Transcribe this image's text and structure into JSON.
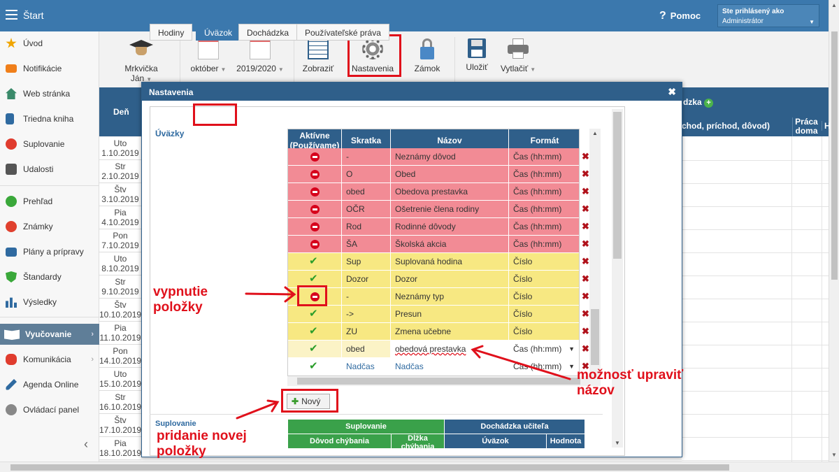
{
  "topbar": {
    "title": "Štart",
    "help": "Pomoc",
    "user_label": "Ste prihlásený ako",
    "user_name": "Administrátor"
  },
  "sidebar": {
    "items": [
      {
        "label": "Úvod",
        "icon": "star-icon",
        "color": "#f0a500"
      },
      {
        "label": "Notifikácie",
        "icon": "envelope-icon",
        "color": "#f07f1a"
      },
      {
        "label": "Web stránka",
        "icon": "home-icon",
        "color": "#3a8a6a"
      },
      {
        "label": "Triedna kniha",
        "icon": "book-icon",
        "color": "#2f6aa0"
      },
      {
        "label": "Suplovanie",
        "icon": "person-icon",
        "color": "#e03c2e"
      },
      {
        "label": "Udalosti",
        "icon": "calendar-icon",
        "color": "#555555"
      },
      {
        "label": "Prehľad",
        "icon": "check-circle-icon",
        "color": "#3aa83a"
      },
      {
        "label": "Známky",
        "icon": "grades-icon",
        "color": "#e0402e"
      },
      {
        "label": "Plány a prípravy",
        "icon": "briefcase-icon",
        "color": "#2f6aa0"
      },
      {
        "label": "Štandardy",
        "icon": "shield-icon",
        "color": "#3aa83a"
      },
      {
        "label": "Výsledky",
        "icon": "bar-chart-icon",
        "color": "#2f6aa0"
      },
      {
        "label": "Vyučovanie",
        "icon": "open-book-icon",
        "color": "#ffffff"
      },
      {
        "label": "Komunikácia",
        "icon": "chat-icon",
        "color": "#e03c2e"
      },
      {
        "label": "Agenda Online",
        "icon": "pen-icon",
        "color": "#2f6aa0"
      },
      {
        "label": "Ovládací panel",
        "icon": "gear-icon",
        "color": "#888888"
      }
    ]
  },
  "toolbar": {
    "teacher": "Mrkvička Ján",
    "month": "október",
    "year": "2019/2020",
    "show": "Zobraziť",
    "settings": "Nastavenia",
    "lock": "Zámok",
    "save": "Uložiť",
    "print": "Vytlačiť"
  },
  "grid": {
    "day_header": "Deň",
    "right_header_a": "dzka",
    "right_header_b": "chod, príchod, dôvod)",
    "right_header_c": "Práca doma",
    "right_header_d": "H",
    "days": [
      {
        "d": "Uto",
        "date": "1.10.2019"
      },
      {
        "d": "Str",
        "date": "2.10.2019"
      },
      {
        "d": "Štv",
        "date": "3.10.2019"
      },
      {
        "d": "Pia",
        "date": "4.10.2019"
      },
      {
        "d": "Pon",
        "date": "7.10.2019"
      },
      {
        "d": "Uto",
        "date": "8.10.2019"
      },
      {
        "d": "Str",
        "date": "9.10.2019"
      },
      {
        "d": "Štv",
        "date": "10.10.2019"
      },
      {
        "d": "Pia",
        "date": "11.10.2019"
      },
      {
        "d": "Pon",
        "date": "14.10.2019"
      },
      {
        "d": "Uto",
        "date": "15.10.2019"
      },
      {
        "d": "Str",
        "date": "16.10.2019"
      },
      {
        "d": "Štv",
        "date": "17.10.2019"
      },
      {
        "d": "Pia",
        "date": "18.10.2019"
      }
    ]
  },
  "dialog": {
    "title": "Nastavenia",
    "tabs": [
      "Hodiny",
      "Úväzok",
      "Dochádzka",
      "Používateľské práva"
    ],
    "section": "Úväzky",
    "columns": [
      "Aktívne (Používame)",
      "Skratka",
      "Názov",
      "Formát"
    ],
    "rows": [
      {
        "active": false,
        "abbr": "-",
        "name": "Neznámy dôvod",
        "format": "Čas (hh:mm)",
        "bg": "#f28b95"
      },
      {
        "active": false,
        "abbr": "O",
        "name": "Obed",
        "format": "Čas (hh:mm)",
        "bg": "#f28b95"
      },
      {
        "active": false,
        "abbr": "obed",
        "name": "Obedova prestavka",
        "format": "Čas (hh:mm)",
        "bg": "#f28b95"
      },
      {
        "active": false,
        "abbr": "OČR",
        "name": "Ošetrenie člena rodiny",
        "format": "Čas (hh:mm)",
        "bg": "#f28b95"
      },
      {
        "active": false,
        "abbr": "Rod",
        "name": "Rodinné dôvody",
        "format": "Čas (hh:mm)",
        "bg": "#f28b95"
      },
      {
        "active": false,
        "abbr": "ŠA",
        "name": "Školská akcia",
        "format": "Čas (hh:mm)",
        "bg": "#f28b95"
      },
      {
        "active": true,
        "abbr": "Sup",
        "name": "Suplovaná hodina",
        "format": "Číslo",
        "bg": "#f7e882"
      },
      {
        "active": true,
        "abbr": "Dozor",
        "name": "Dozor",
        "format": "Číslo",
        "bg": "#f7e882"
      },
      {
        "active": false,
        "abbr": "-",
        "name": "Neznámy typ",
        "format": "Číslo",
        "bg": "#f7e882"
      },
      {
        "active": true,
        "abbr": "->",
        "name": "Presun",
        "format": "Číslo",
        "bg": "#f7e882"
      },
      {
        "active": true,
        "abbr": "ZU",
        "name": "Zmena učebne",
        "format": "Číslo",
        "bg": "#f7e882"
      },
      {
        "active": true,
        "abbr": "obed",
        "name": "obedová prestavka",
        "format": "Čas (hh:mm)",
        "bg": "#fbf3c6"
      },
      {
        "active": true,
        "abbr": "Nadčas",
        "name": "Nadčas",
        "format": "Čas (hh:mm)",
        "bg": "#ffffff"
      }
    ],
    "new_button": "Nový",
    "section2": "Suplovanie",
    "sub_headers": {
      "supl": "Suplovanie",
      "doch": "Dochádzka učiteľa",
      "reason": "Dôvod chýbania",
      "length": "Dĺžka chýbania",
      "load": "Úväzok",
      "value": "Hodnota"
    }
  },
  "annotations": {
    "disable": "vypnutie položky",
    "edit": "možnosť upraviť názov",
    "add": "pridanie novej položky",
    "color": "#e0101b"
  }
}
